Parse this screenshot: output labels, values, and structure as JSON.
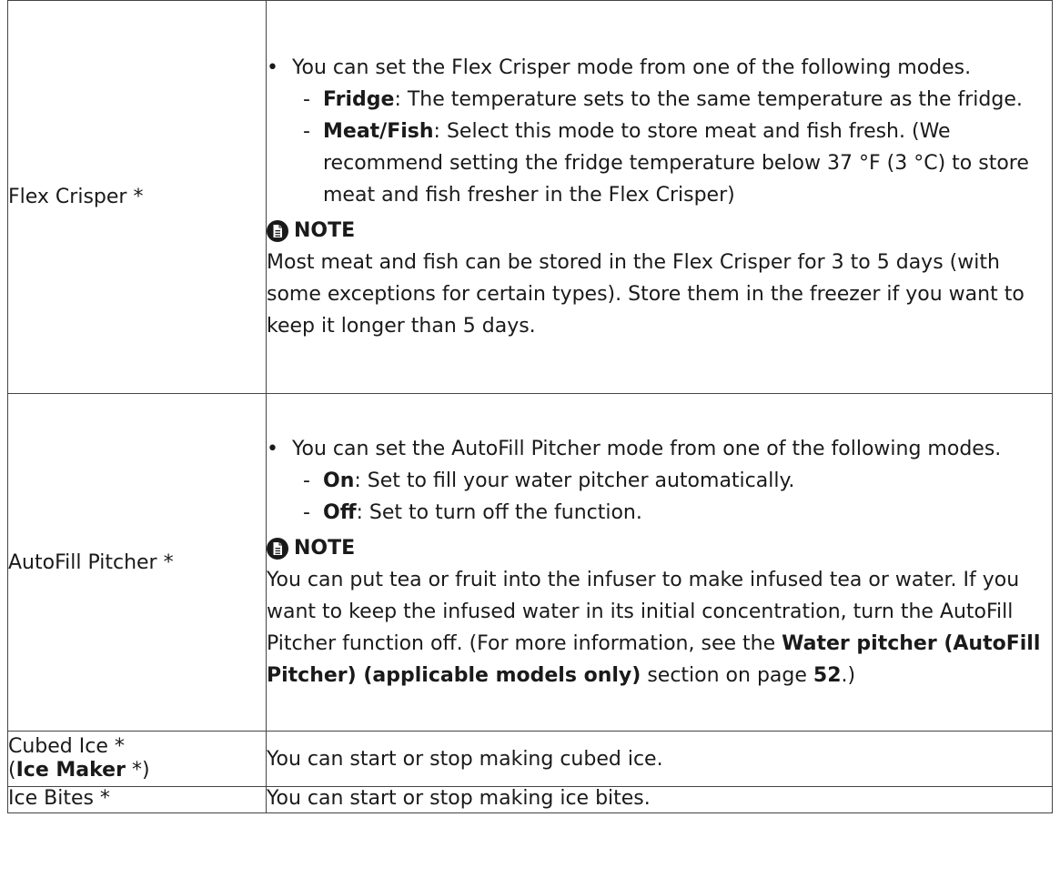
{
  "rows": [
    {
      "label": "Flex Crisper *",
      "intro": "You can set the Flex Crisper mode from one of the following modes.",
      "options": [
        {
          "name": "Fridge",
          "text": ": The temperature sets to the same temperature as the fridge."
        },
        {
          "name": "Meat/Fish",
          "text": ": Select this mode to store meat and fish fresh. (We recommend setting the fridge temperature below 37 °F (3 °C) to store meat and fish fresher in the Flex Crisper)"
        }
      ],
      "note_title": "NOTE",
      "note_text": "Most meat and fish can be stored in the Flex Crisper for 3 to 5 days (with some exceptions for certain types). Store them in the freezer if you want to keep it longer than 5 days."
    },
    {
      "label": "AutoFill Pitcher *",
      "intro": "You can set the AutoFill Pitcher mode from one of the following modes.",
      "options": [
        {
          "name": "On",
          "text": ": Set to fill your water pitcher automatically."
        },
        {
          "name": "Off",
          "text": ": Set to turn off the function."
        }
      ],
      "note_title": "NOTE",
      "note_text_1": "You can put tea or fruit into the infuser to make infused tea or water. If you want to keep the infused water in its initial concentration, turn the AutoFill Pitcher function off. (For more information, see the ",
      "note_link": "Water pitcher (AutoFill Pitcher) (applicable models only)",
      "note_text_2": " section on page ",
      "note_page": "52",
      "note_text_3": ".)"
    },
    {
      "label": "Cubed Ice *",
      "label_2_open": "(",
      "label_2_bold": "Ice Maker",
      "label_2_close": " *)",
      "text": "You can start or stop making cubed ice."
    },
    {
      "label": "Ice Bites *",
      "text": "You can start or stop making ice bites."
    }
  ],
  "icons": {
    "note": "note-document-icon"
  }
}
